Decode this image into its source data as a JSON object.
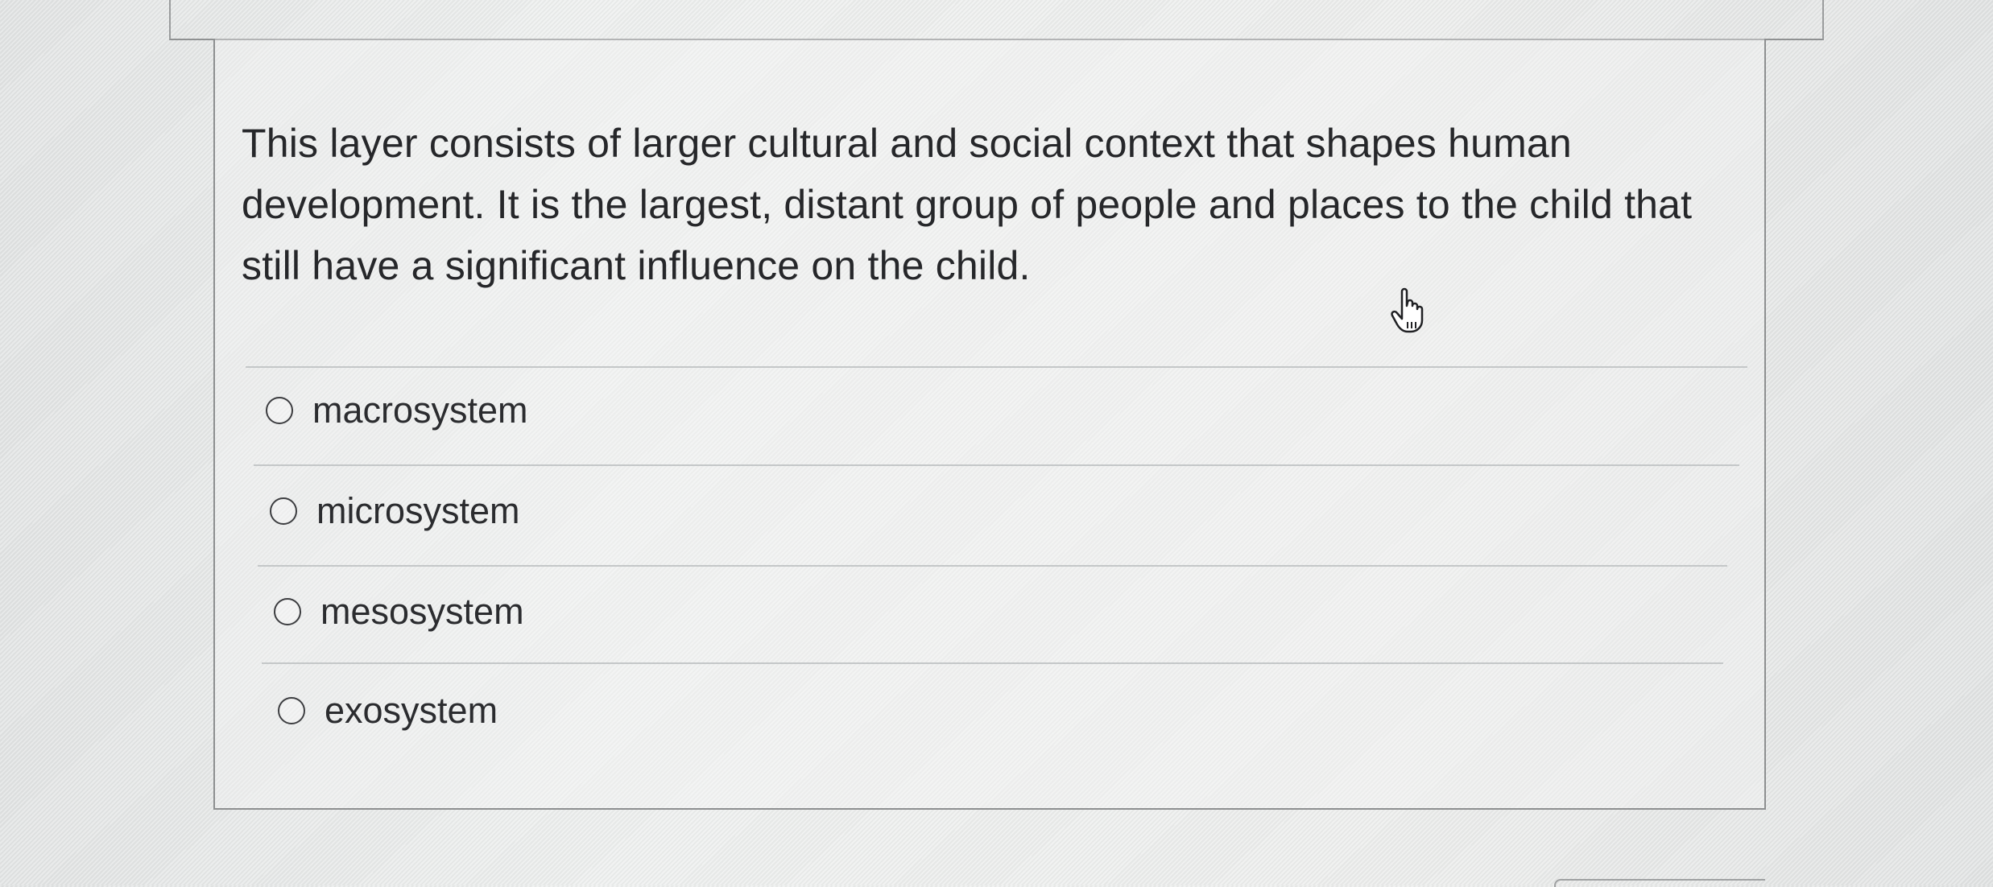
{
  "question": {
    "text": "This layer consists of larger cultural and social context that shapes human development. It is the largest, distant group of people and places to the child that still have a significant influence on the child."
  },
  "options": [
    {
      "label": "macrosystem",
      "selected": false
    },
    {
      "label": "microsystem",
      "selected": false
    },
    {
      "label": "mesosystem",
      "selected": false
    },
    {
      "label": "exosystem",
      "selected": false
    }
  ],
  "cursor": {
    "icon": "hand-pointer-icon"
  },
  "colors": {
    "text": "#26272a",
    "divider": "#c4c7c8",
    "border": "#8d8f90"
  }
}
